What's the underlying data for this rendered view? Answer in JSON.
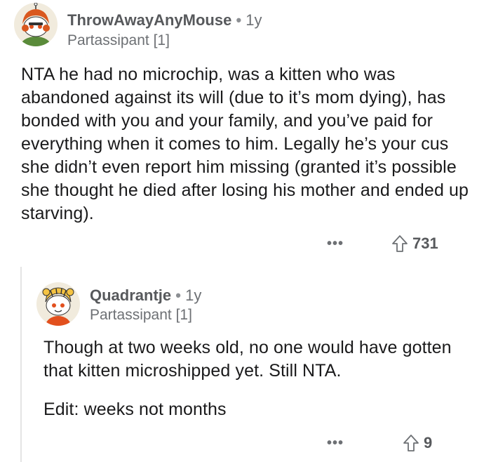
{
  "comments": [
    {
      "username": "ThrowAwayAnyMouse",
      "dot": "•",
      "age": "1y",
      "flair": "Partassipant [1]",
      "body": "NTA he had no microchip, was a kitten who was abandoned against its will (due to it’s mom dying), has bonded with you and your family, and you’ve paid for everything when it comes to him. Legally he’s your cus she didn’t even report him missing (granted it’s possible she thought he died after losing his mother and ended up starving).",
      "more_label": "•••",
      "score": "731"
    },
    {
      "username": "Quadrantje",
      "dot": "•",
      "age": "1y",
      "flair": "Partassipant [1]",
      "body_p1": "Though at two weeks old, no one would have gotten that kitten microshipped yet. Still NTA.",
      "body_p2": "Edit: weeks not months",
      "more_label": "•••",
      "score": "9"
    }
  ],
  "colors": {
    "text": "#1a1a1b",
    "meta": "#6d7074",
    "thread_line": "#e4e4e4"
  },
  "icons": [
    "avatar-snoo-redhead",
    "avatar-snoo-tiger",
    "upvote-arrow-icon",
    "more-options-icon"
  ]
}
